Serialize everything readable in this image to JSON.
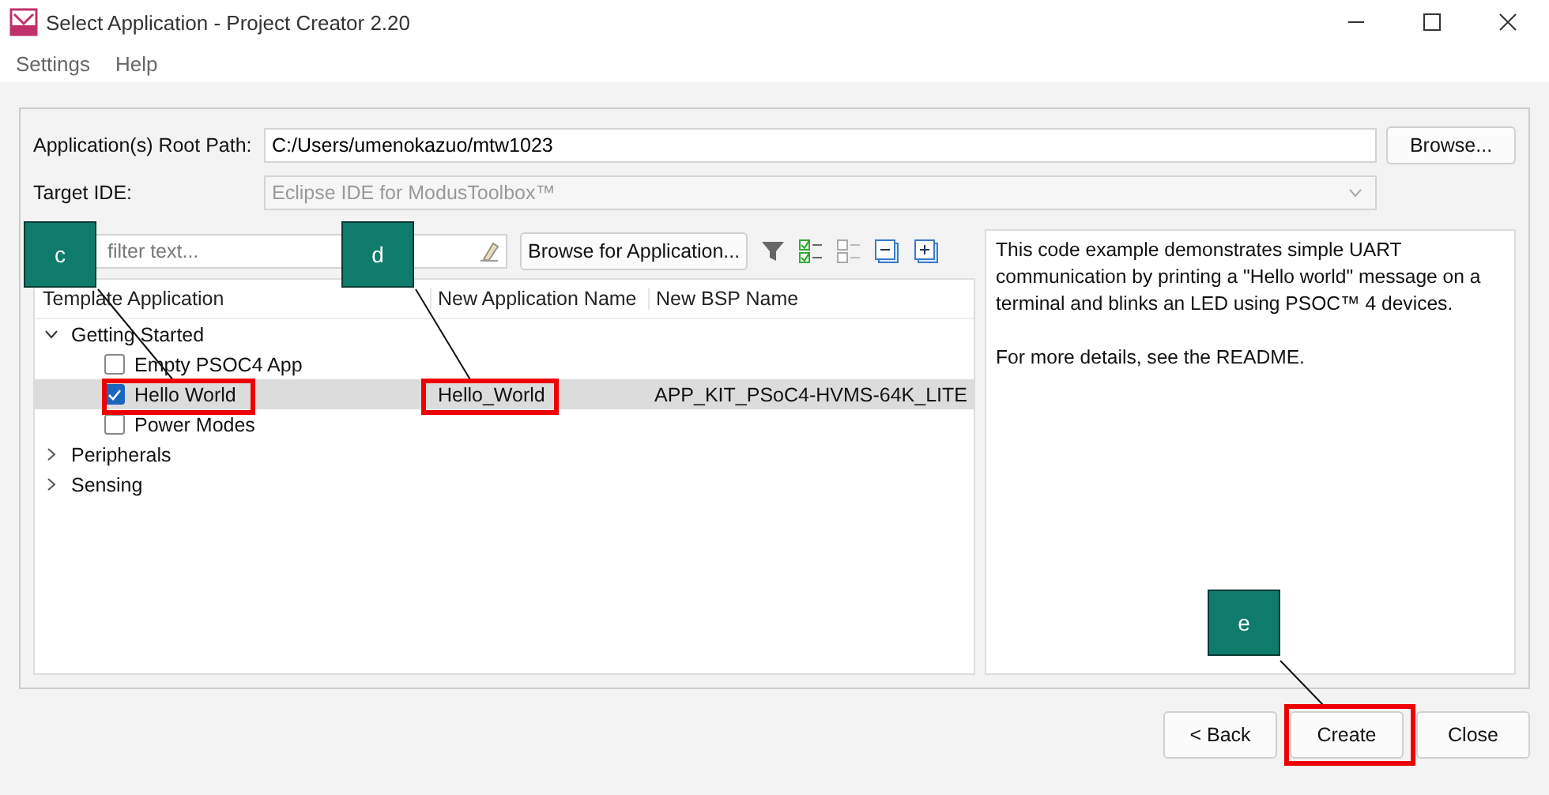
{
  "window": {
    "title": "Select Application - Project Creator 2.20"
  },
  "menu": [
    {
      "label": "Settings"
    },
    {
      "label": "Help"
    }
  ],
  "root_path": {
    "label": "Application(s) Root Path:",
    "value": "C:/Users/umenokazuo/mtw1023",
    "button": "Browse..."
  },
  "target_ide": {
    "label": "Target IDE:",
    "value": "Eclipse IDE for ModusToolbox™",
    "disabled": true
  },
  "filter": {
    "placeholder": "filter text..."
  },
  "browse_button": "Browse for Application...",
  "tree": {
    "columns": [
      "Template Application",
      "New Application Name",
      "New BSP Name"
    ],
    "items": [
      {
        "label": "Getting Started",
        "expanded": true,
        "children": [
          {
            "label": "Empty PSOC4 App",
            "checked": false,
            "selected": false
          },
          {
            "label": "Hello World",
            "checked": true,
            "selected": true,
            "app_name": "Hello_World",
            "bsp_name": "APP_KIT_PSoC4-HVMS-64K_LITE"
          },
          {
            "label": "Power Modes",
            "checked": false,
            "selected": false
          }
        ]
      },
      {
        "label": "Peripherals",
        "expanded": false
      },
      {
        "label": "Sensing",
        "expanded": false
      }
    ]
  },
  "description": [
    "This code example demonstrates simple UART communication by printing a \"Hello world\" message on a terminal and blinks an LED using PSOC™ 4 devices.",
    "For more details, see the README."
  ],
  "buttons": [
    {
      "label": "< Back"
    },
    {
      "label": "Create"
    },
    {
      "label": "Close"
    }
  ],
  "callouts": [
    {
      "label": "c"
    },
    {
      "label": "d"
    },
    {
      "label": "e"
    }
  ]
}
